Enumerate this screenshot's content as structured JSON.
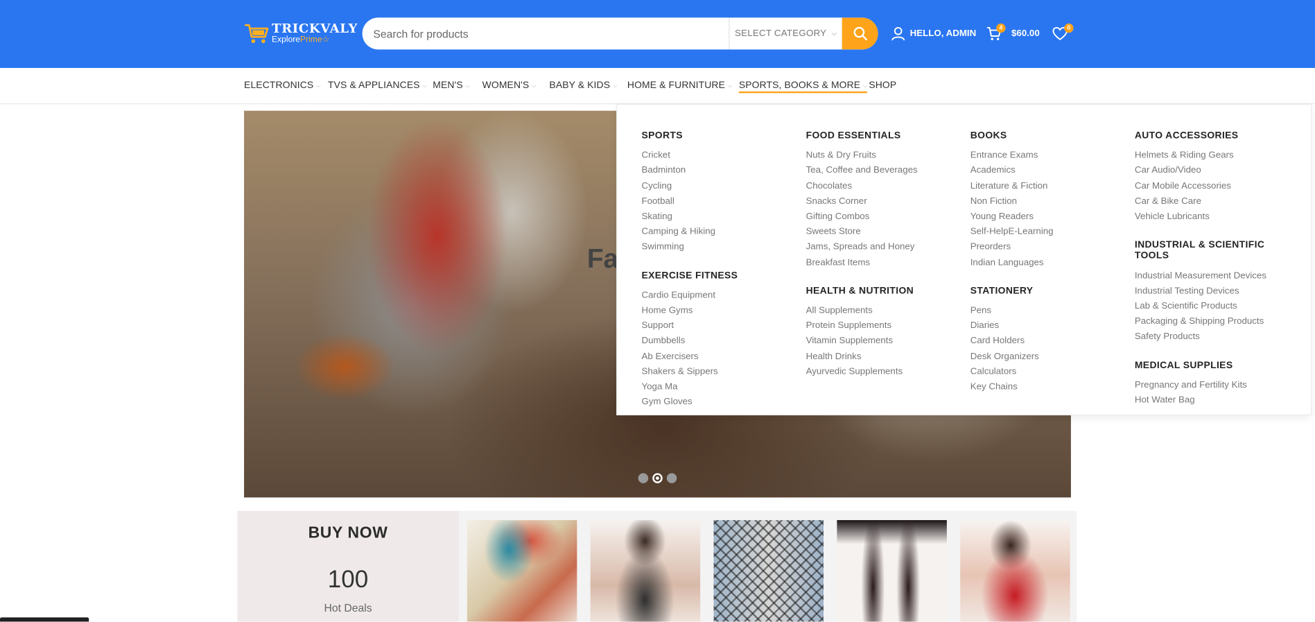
{
  "header": {
    "logo_main": "TRICKVALY",
    "logo_sub_1": "Explore",
    "logo_sub_2": "Prime",
    "search_placeholder": "Search for products",
    "category_label": "SELECT CATEGORY",
    "user_label": "HELLO, ADMIN",
    "cart_count": "4",
    "cart_total": "$60.00",
    "wishlist_count": "0",
    "brand_color": "#2a76f1",
    "accent_color": "#ffa31a"
  },
  "nav": {
    "items": [
      {
        "label": "ELECTRONICS",
        "has_dropdown": true
      },
      {
        "label": "TVS & APPLIANCES",
        "has_dropdown": true
      },
      {
        "label": "MEN'S",
        "has_dropdown": true
      },
      {
        "label": "WOMEN'S",
        "has_dropdown": true
      },
      {
        "label": "BABY & KIDS",
        "has_dropdown": true
      },
      {
        "label": "HOME & FURNITURE",
        "has_dropdown": true
      },
      {
        "label": "SPORTS, BOOKS & MORE",
        "has_dropdown": true,
        "active": true
      },
      {
        "label": "SHOP",
        "has_dropdown": false
      }
    ]
  },
  "slider": {
    "heading_visible": "Fa",
    "dots": 3,
    "active_dot": 2
  },
  "mega_menu": {
    "columns": [
      [
        {
          "title": "SPORTS",
          "links": [
            "Cricket",
            "Badminton",
            "Cycling",
            "Football",
            "Skating",
            "Camping & Hiking",
            "Swimming"
          ]
        },
        {
          "title": "EXERCISE FITNESS",
          "links": [
            "Cardio Equipment",
            "Home Gyms",
            "Support",
            "Dumbbells",
            "Ab Exercisers",
            "Shakers & Sippers",
            "Yoga Ma",
            "Gym Gloves"
          ]
        }
      ],
      [
        {
          "title": "FOOD ESSENTIALS",
          "links": [
            "Nuts & Dry Fruits",
            "Tea, Coffee and Beverages",
            "Chocolates",
            "Snacks Corner",
            "Gifting Combos",
            "Sweets Store",
            "Jams, Spreads and Honey",
            "Breakfast Items"
          ]
        },
        {
          "title": "HEALTH & NUTRITION",
          "links": [
            "All Supplements",
            "Protein Supplements",
            "Vitamin Supplements",
            "Health Drinks",
            "Ayurvedic Supplements"
          ]
        }
      ],
      [
        {
          "title": "BOOKS",
          "links": [
            "Entrance Exams",
            "Academics",
            "Literature & Fiction",
            "Non Fiction",
            "Young Readers",
            "Self-HelpE-Learning",
            "Preorders",
            "Indian Languages"
          ]
        },
        {
          "title": "STATIONERY",
          "links": [
            "Pens",
            "Diaries",
            "Card Holders",
            "Desk Organizers",
            "Calculators",
            "Key Chains"
          ]
        }
      ],
      [
        {
          "title": "AUTO ACCESSORIES",
          "links": [
            "Helmets & Riding Gears",
            "Car Audio/Video",
            "Car Mobile Accessories",
            "Car & Bike Care",
            "Vehicle Lubricants"
          ]
        },
        {
          "title": "INDUSTRIAL & SCIENTIFIC TOOLS",
          "links": [
            "Industrial Measurement Devices",
            "Industrial Testing Devices",
            "Lab & Scientific Products",
            "Packaging & Shipping Products",
            "Safety Products"
          ]
        },
        {
          "title": "MEDICAL SUPPLIES",
          "links": [
            "Pregnancy and Fertility Kits",
            "Hot Water Bag"
          ]
        }
      ]
    ]
  },
  "deals": {
    "title": "BUY NOW",
    "count": "100",
    "subtitle": "Hot Deals",
    "products": [
      "cap-product-image",
      "waist-trainer-product-image",
      "fishnet-jeans-product-image",
      "stockings-product-image",
      "lingerie-product-image"
    ]
  }
}
